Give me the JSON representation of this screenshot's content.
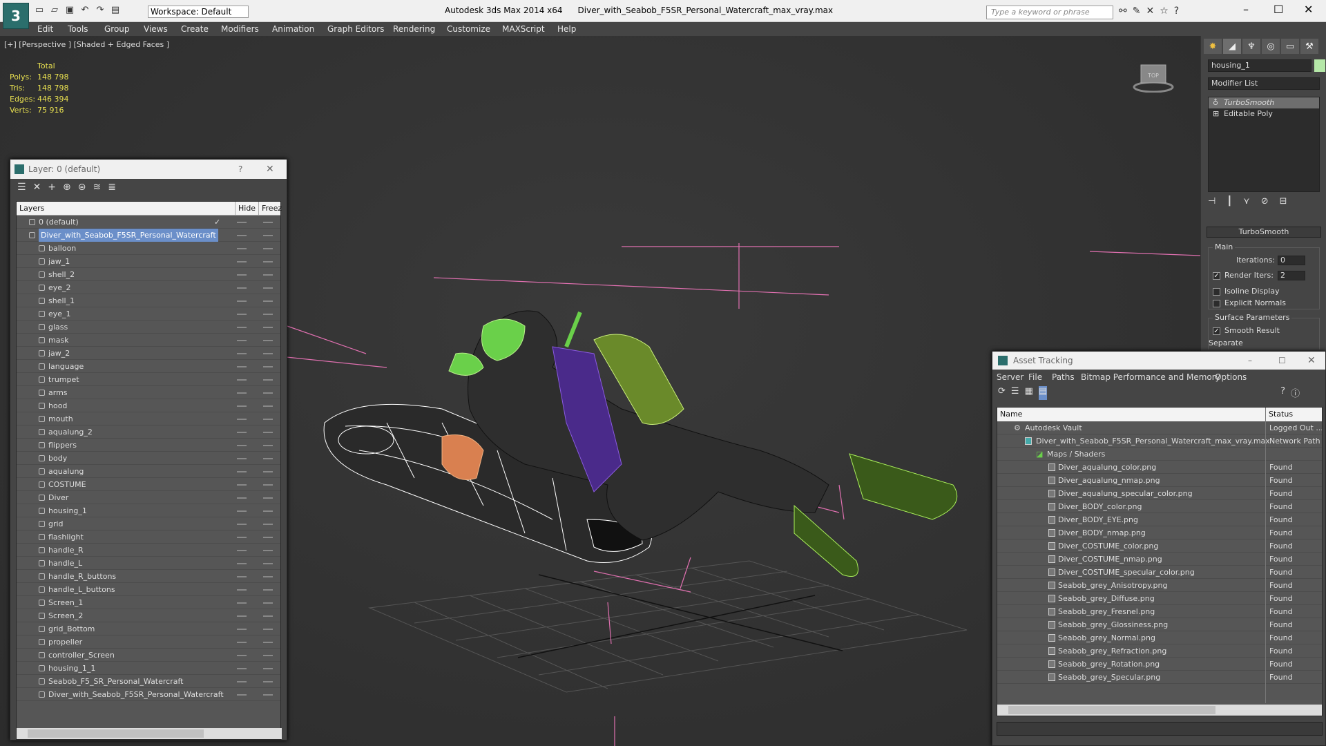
{
  "app": {
    "logo": "3",
    "workspace": "Workspace: Default",
    "product": "Autodesk 3ds Max  2014 x64",
    "filename": "Diver_with_Seabob_F5SR_Personal_Watercraft_max_vray.max",
    "search_placeholder": "Type a keyword or phrase"
  },
  "menu": [
    "Edit",
    "Tools",
    "Group",
    "Views",
    "Create",
    "Modifiers",
    "Animation",
    "Graph Editors",
    "Rendering",
    "Customize",
    "MAXScript",
    "Help"
  ],
  "viewport": {
    "label": "[+] [Perspective ] [Shaded + Edged Faces ]",
    "stats_header": "Total",
    "stats": [
      {
        "k": "Polys:",
        "v": "148 798"
      },
      {
        "k": "Tris:",
        "v": "148 798"
      },
      {
        "k": "Edges:",
        "v": "446 394"
      },
      {
        "k": "Verts:",
        "v": "75 916"
      }
    ]
  },
  "command_panel": {
    "object_name": "housing_1",
    "object_color": "#b5e8a8",
    "modifier_list": "Modifier List",
    "stack": [
      "TurboSmooth",
      "Editable Poly"
    ],
    "rollout": "TurboSmooth",
    "main_group": "Main",
    "iterations_label": "Iterations:",
    "iterations_value": "0",
    "render_iters_label": "Render Iters:",
    "render_iters_value": "2",
    "isoline": "Isoline Display",
    "explicit": "Explicit Normals",
    "surface_group": "Surface Parameters",
    "smooth": "Smooth Result",
    "separate": "Separate"
  },
  "layer_window": {
    "title": "Layer: 0 (default)",
    "help": "?",
    "col_layers": "Layers",
    "col_hide": "Hide",
    "col_freeze": "Freez",
    "default_layer": "0 (default)",
    "main_layer": "Diver_with_Seabob_F5SR_Personal_Watercraft",
    "objects": [
      "balloon",
      "jaw_1",
      "shell_2",
      "eye_2",
      "shell_1",
      "eye_1",
      "glass",
      "mask",
      "jaw_2",
      "language",
      "trumpet",
      "arms",
      "hood",
      "mouth",
      "aqualung_2",
      "flippers",
      "body",
      "aqualung",
      "COSTUME",
      "Diver",
      "housing_1",
      "grid",
      "flashlight",
      "handle_R",
      "handle_L",
      "handle_R_buttons",
      "handle_L_buttons",
      "Screen_1",
      "Screen_2",
      "grid_Bottom",
      "propeller",
      "controller_Screen",
      "housing_1_1",
      "Seabob_F5_SR_Personal_Watercraft",
      "Diver_with_Seabob_F5SR_Personal_Watercraft"
    ]
  },
  "asset_window": {
    "title": "Asset Tracking",
    "menu": [
      "Server",
      "File",
      "Paths",
      "Bitmap Performance and Memory",
      "Options"
    ],
    "col_name": "Name",
    "col_status": "Status",
    "vault": {
      "name": "Autodesk Vault",
      "status": "Logged Out ..."
    },
    "file": {
      "name": "Diver_with_Seabob_F5SR_Personal_Watercraft_max_vray.max",
      "status": "Network Path"
    },
    "maps": "Maps / Shaders",
    "found": "Found",
    "assets": [
      "Diver_aqualung_color.png",
      "Diver_aqualung_nmap.png",
      "Diver_aqualung_specular_color.png",
      "Diver_BODY_color.png",
      "Diver_BODY_EYE.png",
      "Diver_BODY_nmap.png",
      "Diver_COSTUME_color.png",
      "Diver_COSTUME_nmap.png",
      "Diver_COSTUME_specular_color.png",
      "Seabob_grey_Anisotropy.png",
      "Seabob_grey_Diffuse.png",
      "Seabob_grey_Fresnel.png",
      "Seabob_grey_Glossiness.png",
      "Seabob_grey_Normal.png",
      "Seabob_grey_Refraction.png",
      "Seabob_grey_Rotation.png",
      "Seabob_grey_Specular.png"
    ]
  },
  "gizmo_label": "TOP"
}
